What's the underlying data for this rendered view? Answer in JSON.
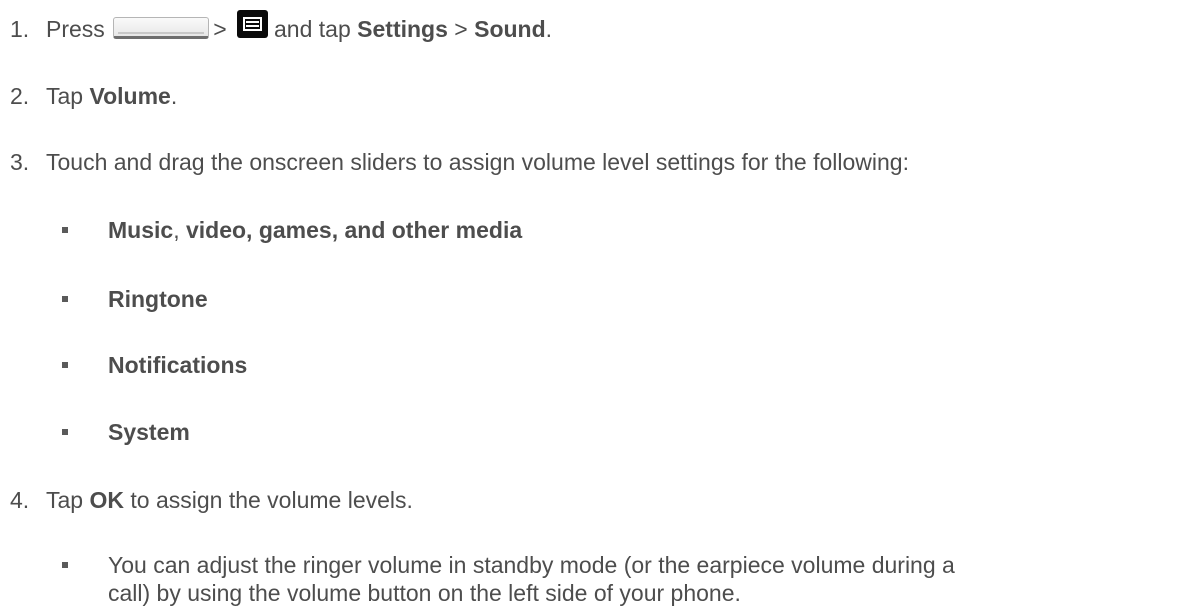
{
  "steps": [
    {
      "number": "1.",
      "press": "Press",
      "sep1": ">",
      "and_tap": "and tap",
      "settings": "Settings",
      "sep2": ">",
      "sound": "Sound",
      "end": "."
    },
    {
      "number": "2.",
      "tap": "Tap",
      "volume": "Volume",
      "end": "."
    },
    {
      "number": "3.",
      "text": "Touch and drag the onscreen sliders to assign volume level settings for the following:"
    },
    {
      "number": "4.",
      "tap": "Tap",
      "ok": "OK",
      "rest": "to assign the volume levels."
    }
  ],
  "sliders": {
    "music_bold": "Music",
    "comma": ",",
    "media_bold": "video, games, and other media",
    "ringtone": "Ringtone",
    "notifications": "Notifications",
    "system": "System"
  },
  "note": {
    "line1": "You can adjust the ringer volume in standby mode (or the earpiece volume during a",
    "line2": "call) by using the volume button on the left side of your phone."
  },
  "icons": {
    "home_key": "home-key-icon",
    "menu_key": "menu-key-icon"
  }
}
